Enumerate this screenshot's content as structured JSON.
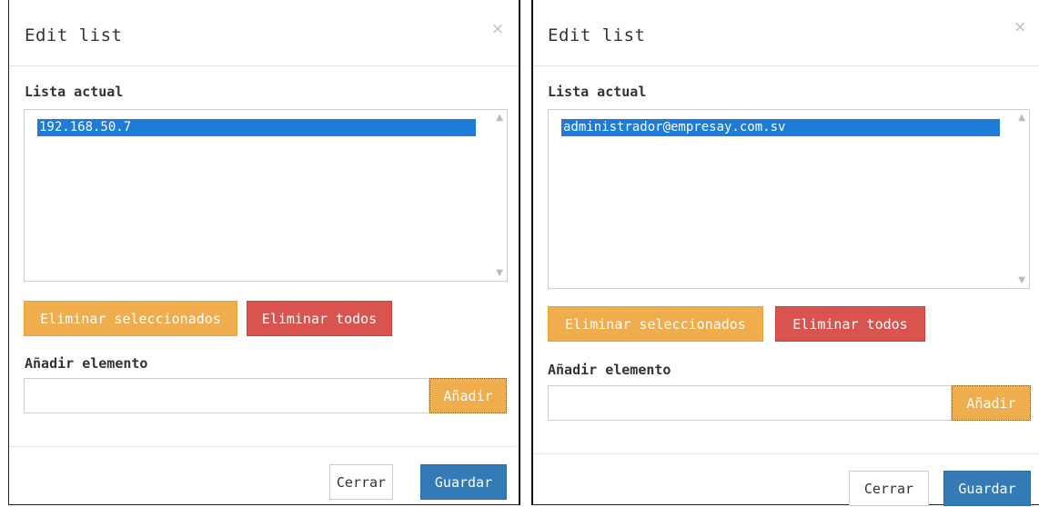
{
  "modals": [
    {
      "title": "Edit list",
      "close_glyph": "×",
      "current_list_label": "Lista actual",
      "list_items": [
        "192.168.50.7"
      ],
      "remove_selected_label": "Eliminar seleccionados",
      "remove_all_label": "Eliminar todos",
      "add_element_label": "Añadir elemento",
      "add_input_value": "",
      "add_button_label": "Añadir",
      "close_button_label": "Cerrar",
      "save_button_label": "Guardar"
    },
    {
      "title": "Edit list",
      "close_glyph": "×",
      "current_list_label": "Lista actual",
      "list_items": [
        "administrador@empresay.com.sv"
      ],
      "remove_selected_label": "Eliminar seleccionados",
      "remove_all_label": "Eliminar todos",
      "add_element_label": "Añadir elemento",
      "add_input_value": "",
      "add_button_label": "Añadir",
      "close_button_label": "Cerrar",
      "save_button_label": "Guardar"
    }
  ],
  "colors": {
    "selection": "#1e7bd7",
    "warning": "#f0ad4e",
    "danger": "#d9534f",
    "primary": "#337ab7"
  }
}
